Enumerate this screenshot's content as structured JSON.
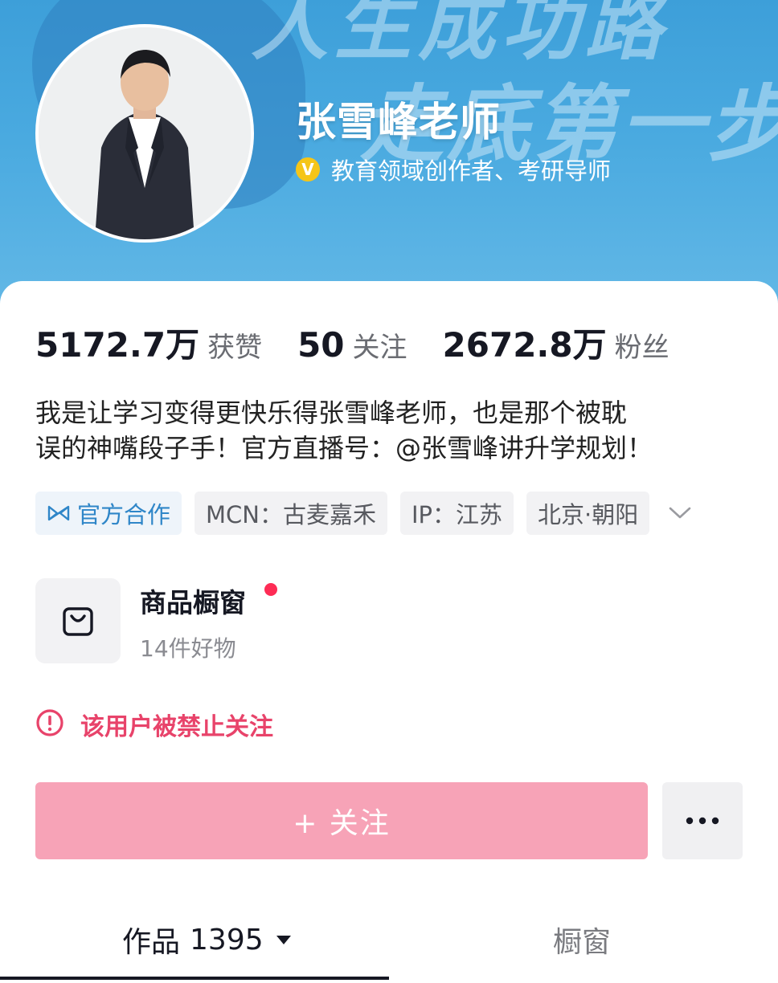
{
  "banner": {
    "background_text_line1": "人生成功路",
    "background_text_line2": "走底第一步"
  },
  "profile": {
    "name": "张雪峰老师",
    "verified_icon": "verified-v-icon",
    "verification": "教育领域创作者、考研导师"
  },
  "stats": [
    {
      "value": "5172.7万",
      "label": "获赞"
    },
    {
      "value": "50",
      "label": "关注"
    },
    {
      "value": "2672.8万",
      "label": "粉丝"
    }
  ],
  "bio": {
    "line1": "我是让学习变得更快乐得张雪峰老师，也是那个被耽",
    "line2": "误的神嘴段子手！官方直播号：@张雪峰讲升学规划！"
  },
  "tags": {
    "official": "官方合作",
    "mcn": "MCN：古麦嘉禾",
    "ip": "IP：江苏",
    "location": "北京·朝阳"
  },
  "shop": {
    "title": "商品橱窗",
    "subtitle": "14件好物"
  },
  "notice": {
    "text": "该用户被禁止关注"
  },
  "actions": {
    "follow_label": "+ 关注",
    "more_icon": "more-dots-icon"
  },
  "tabs": {
    "works_label": "作品",
    "works_count": "1395",
    "shop_label": "橱窗"
  },
  "colors": {
    "banner": "#4aaae0",
    "follow_button": "#f7a3b7",
    "warning": "#e8436a",
    "official_tag": "#2f86c8",
    "red_dot": "#fe2c55"
  }
}
